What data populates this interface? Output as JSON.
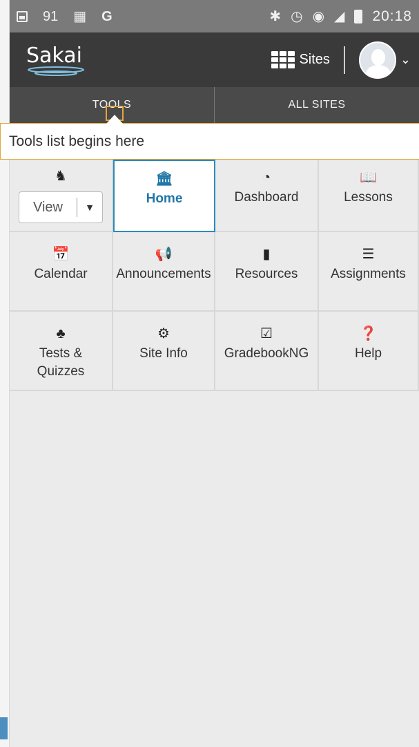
{
  "status": {
    "time": "20:18",
    "icons": [
      "image-icon",
      "number-icon",
      "calendar-icon",
      "google-icon",
      "bluetooth-icon",
      "alarm-icon",
      "wifi-icon",
      "signal-icon",
      "battery-icon"
    ],
    "num": "91",
    "g": "G"
  },
  "header": {
    "logo": "Sakai",
    "sites_label": "Sites",
    "accent": "#2b8bbf"
  },
  "tabs": [
    {
      "label": "TOOLS"
    },
    {
      "label": "ALL SITES"
    }
  ],
  "tooltip": {
    "text": "Tools list begins here"
  },
  "tools": {
    "view": {
      "label": "View",
      "icon": "spy-icon"
    },
    "items": [
      {
        "label": "Home",
        "icon": "bank-icon",
        "active": true
      },
      {
        "label": "Dashboard",
        "icon": "dashboard-icon"
      },
      {
        "label": "Lessons",
        "icon": "book-icon"
      },
      {
        "label": "Calendar",
        "icon": "calendar-icon"
      },
      {
        "label": "Announcements",
        "icon": "bullhorn-icon"
      },
      {
        "label": "Resources",
        "icon": "folder-icon"
      },
      {
        "label": "Assignments",
        "icon": "tasks-icon"
      },
      {
        "label": "Tests &",
        "label2": "Quizzes",
        "icon": "puzzle-icon"
      },
      {
        "label": "Site Info",
        "icon": "gear-icon"
      },
      {
        "label": "GradebookNG",
        "icon": "check-square-icon"
      },
      {
        "label": "Help",
        "icon": "question-icon"
      }
    ]
  }
}
